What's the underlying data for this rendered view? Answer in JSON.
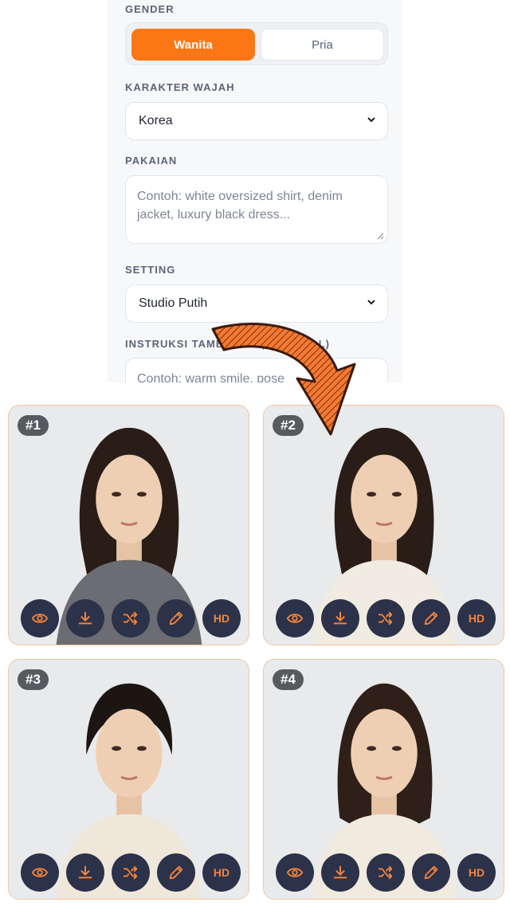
{
  "form": {
    "gender": {
      "label": "GENDER",
      "options": [
        "Wanita",
        "Pria"
      ],
      "selected": "Wanita"
    },
    "karakter": {
      "label": "KARAKTER WAJAH",
      "value": "Korea"
    },
    "pakaian": {
      "label": "PAKAIAN",
      "placeholder_line1": "Contoh: white oversized shirt, denim",
      "placeholder_line2": "jacket, luxury black dress..."
    },
    "setting": {
      "label": "SETTING",
      "value": "Studio Putih"
    },
    "instruksi": {
      "label": "INSTRUKSI TAMBAHAN (OPSIONAL)",
      "placeholder": "Contoh: warm smile, pose"
    }
  },
  "results": [
    {
      "badge": "#1",
      "sweater": "#6b6d72"
    },
    {
      "badge": "#2",
      "sweater": "#f1ece1"
    },
    {
      "badge": "#3",
      "sweater": "#efe7da"
    },
    {
      "badge": "#4",
      "sweater": "#f0eadf"
    }
  ],
  "actions": [
    {
      "name": "view",
      "icon": "eye-icon"
    },
    {
      "name": "download",
      "icon": "download-icon"
    },
    {
      "name": "shuffle",
      "icon": "shuffle-icon"
    },
    {
      "name": "edit",
      "icon": "pencil-icon"
    },
    {
      "name": "hd",
      "label": "HD"
    }
  ],
  "colors": {
    "accent": "#fb7716",
    "action_bg": "#2c3249",
    "action_icon": "#f5843a",
    "arrow": "#f47a33"
  }
}
